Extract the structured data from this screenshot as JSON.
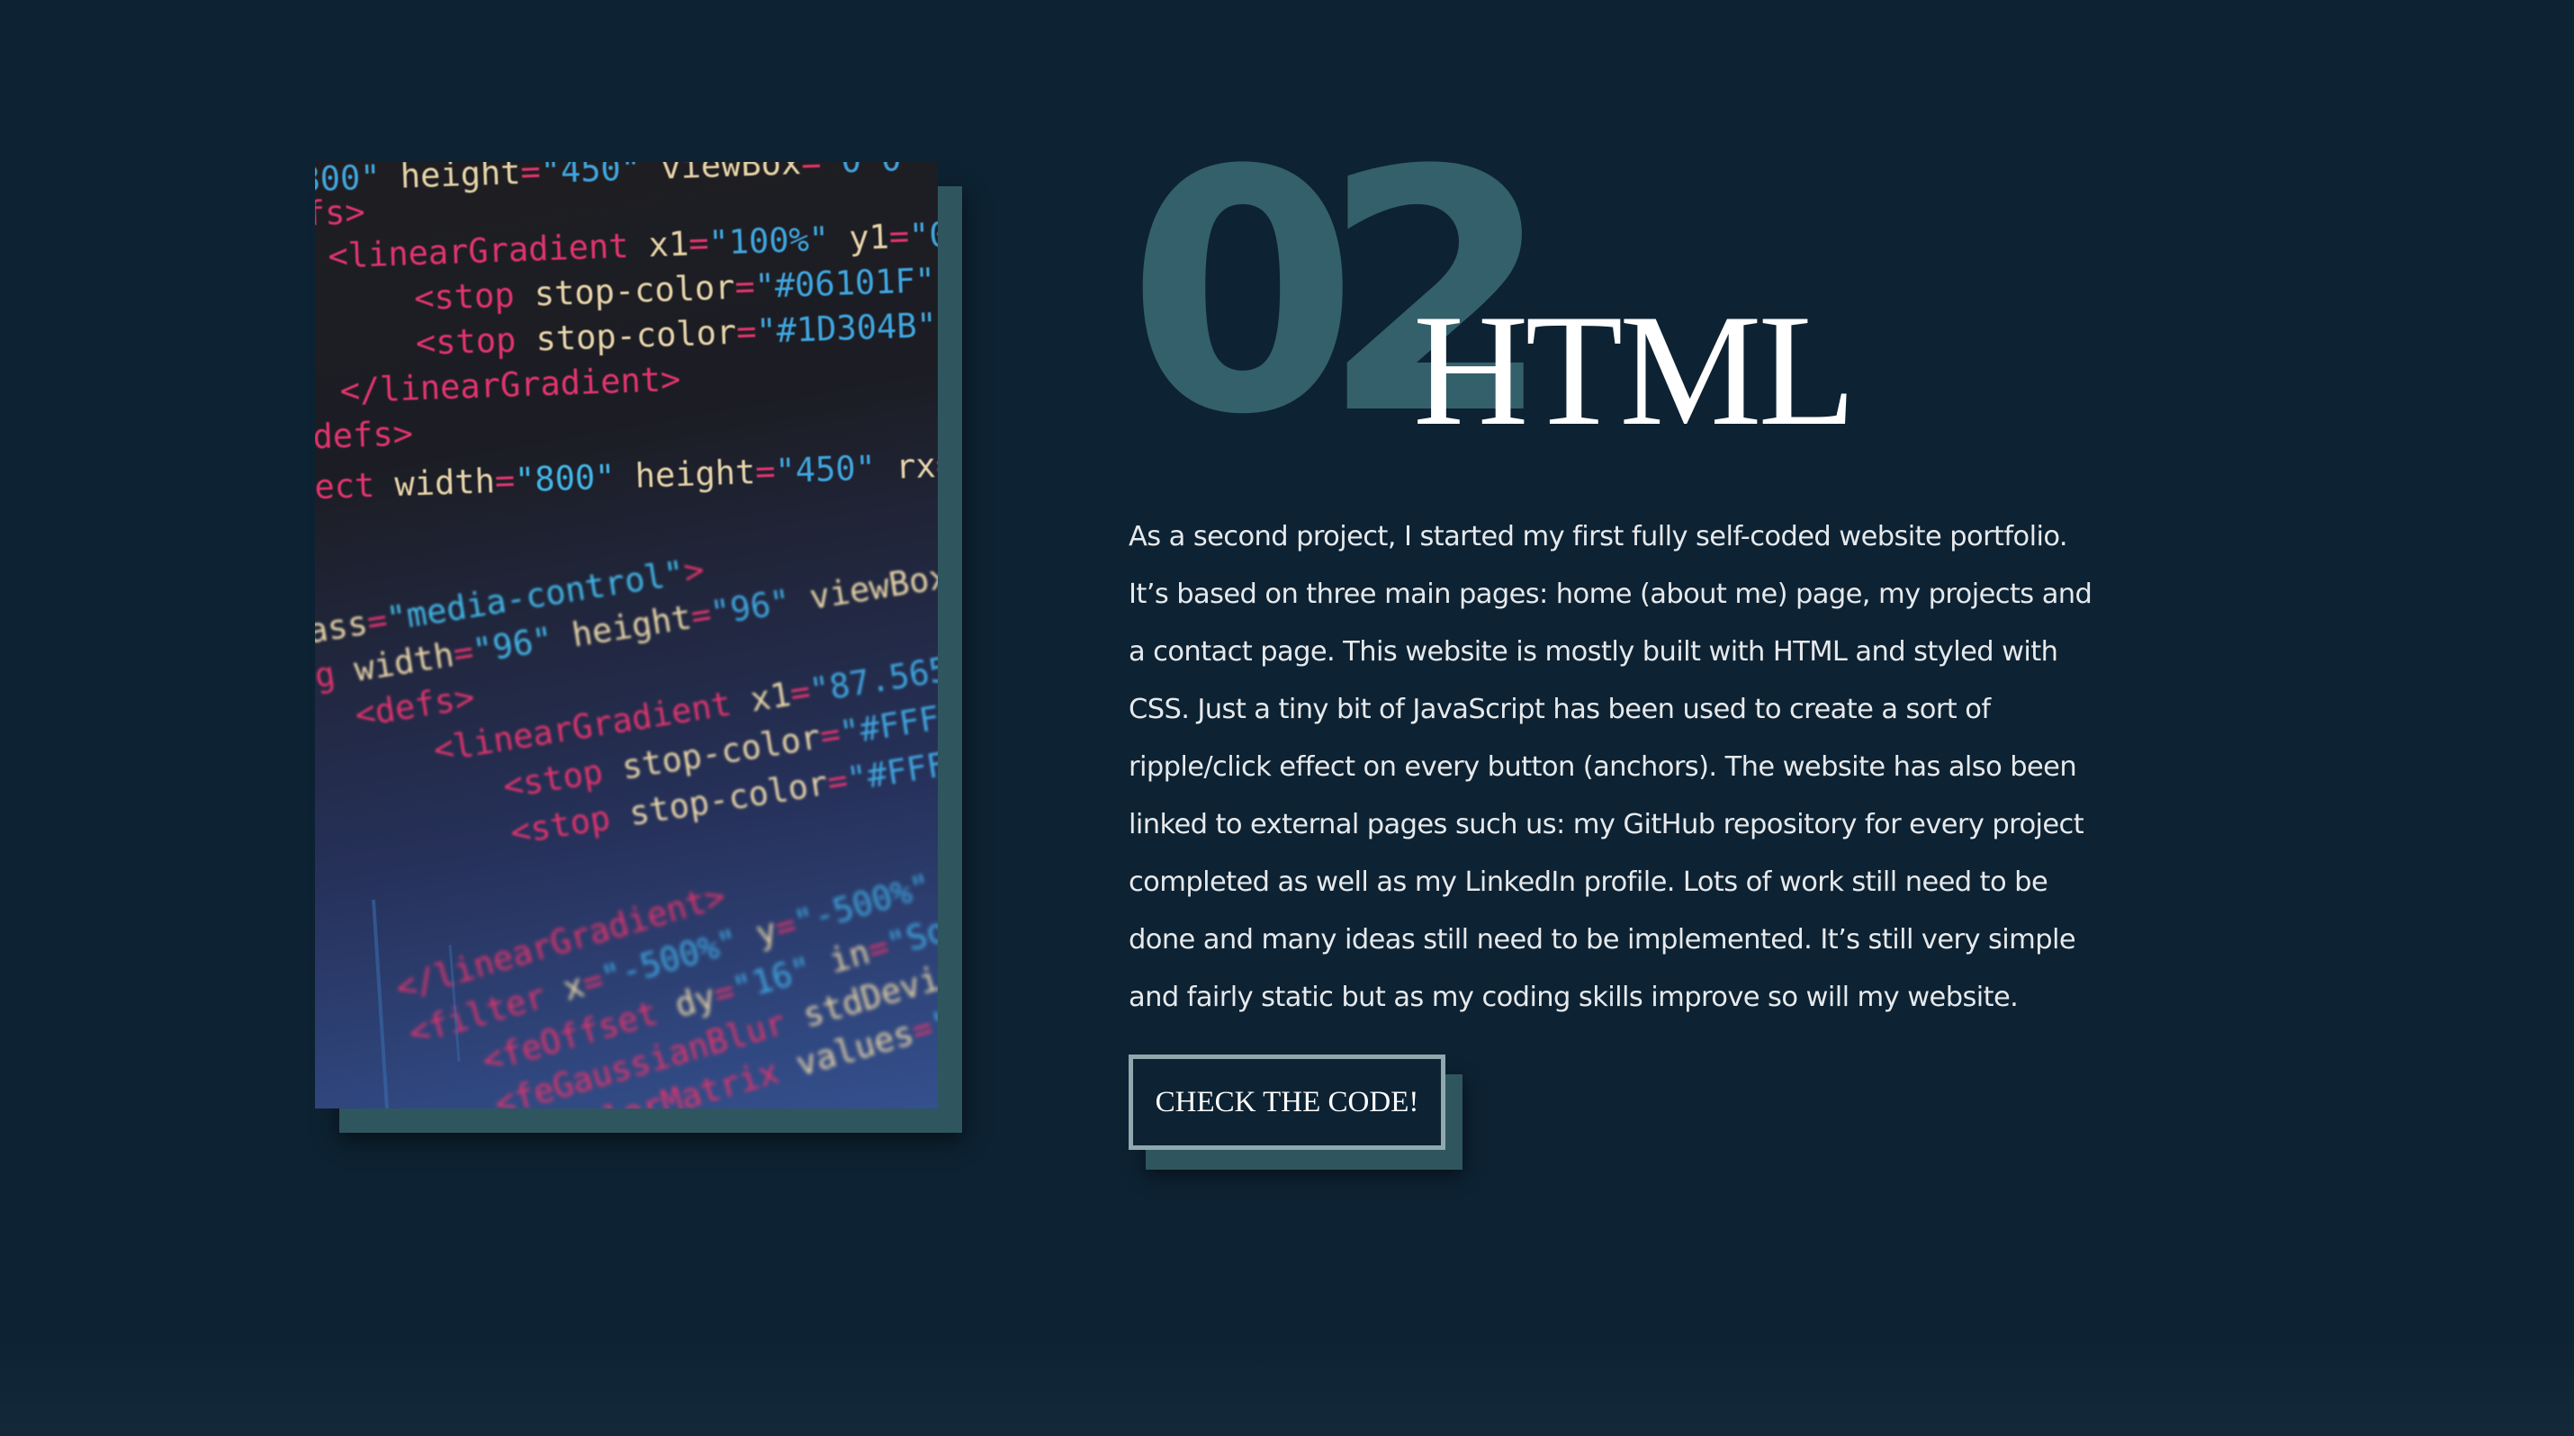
{
  "project": {
    "number": "02",
    "title": "HTML",
    "description": "As a second project, I started my first fully self-coded website portfolio. It’s based on three main pages: home (about me) page, my projects and a contact page. This website is mostly built with HTML and styled with CSS. Just a tiny bit of JavaScript has been used to create a sort of ripple/click effect on every button (anchors). The website has also been linked to external pages such us: my GitHub repository for every project completed as well as my LinkedIn profile. Lots of work still need to be done and many ideas still need to be implemented. It’s still very simple and fairly static but as my coding skills improve so will my website.",
    "button_label": "CHECK THE CODE!"
  },
  "colors": {
    "background": "#0d2232",
    "accent": "#33606a",
    "button_border": "#8fa9ae"
  }
}
